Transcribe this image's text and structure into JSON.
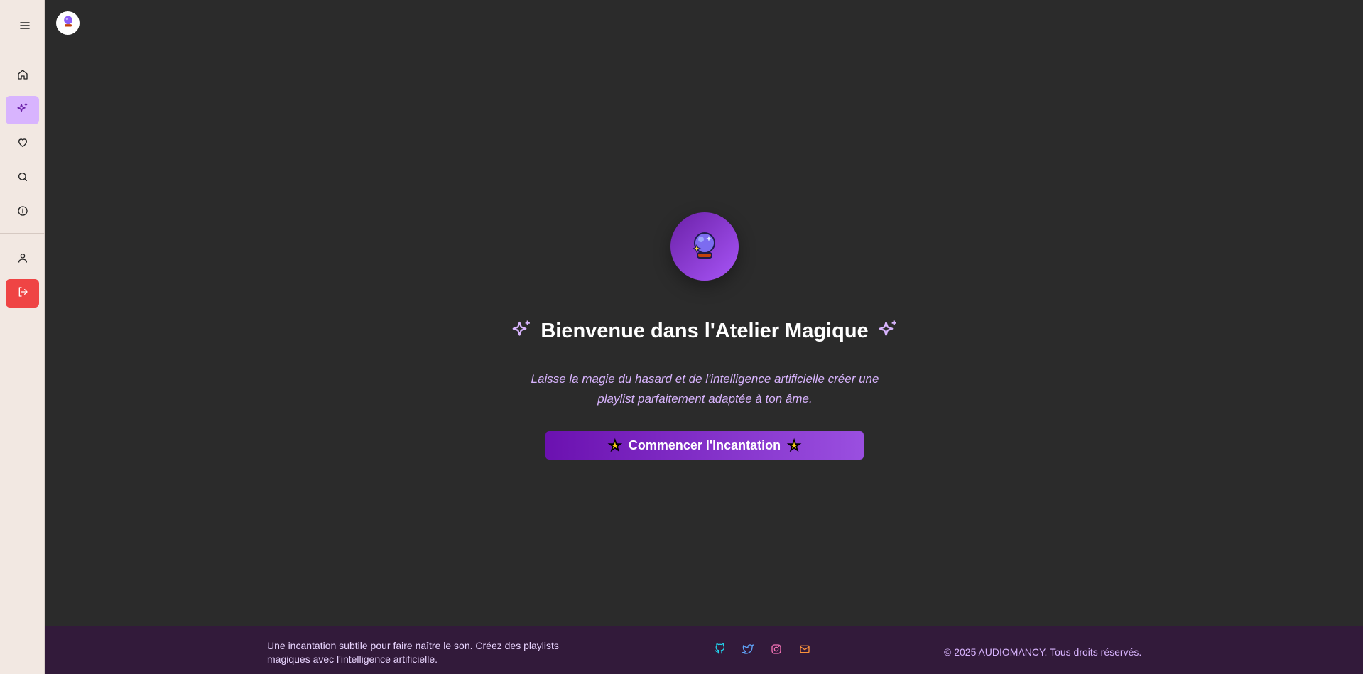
{
  "sidebar": {
    "menu_icon": "hamburger-menu-icon",
    "items": [
      {
        "name": "home",
        "icon": "home-icon"
      },
      {
        "name": "atelier",
        "icon": "sparkles-icon",
        "active": true
      },
      {
        "name": "favorites",
        "icon": "heart-icon"
      },
      {
        "name": "search",
        "icon": "search-icon"
      },
      {
        "name": "about",
        "icon": "info-icon"
      }
    ],
    "bottom_items": [
      {
        "name": "profile",
        "icon": "user-icon"
      },
      {
        "name": "logout",
        "icon": "log-out-icon"
      }
    ]
  },
  "header": {
    "logo_icon": "crystal-ball-icon"
  },
  "main": {
    "hero_icon": "🔮",
    "title": "Bienvenue dans l'Atelier Magique",
    "subtitle": "Laisse la magie du hasard et de l'intelligence artificielle créer une playlist parfaitement adaptée à ton âme.",
    "cta_label": "Commencer l'Incantation",
    "cta_star": "★"
  },
  "footer": {
    "description": "Une incantation subtile pour faire naître le son. Créez des playlists magiques avec l'intelligence artificielle.",
    "socials": [
      {
        "name": "github",
        "icon": "github-icon",
        "color": "#22d3ee"
      },
      {
        "name": "twitter",
        "icon": "twitter-icon",
        "color": "#60a5fa"
      },
      {
        "name": "instagram",
        "icon": "instagram-icon",
        "color": "#f472b6"
      },
      {
        "name": "email",
        "icon": "mail-icon",
        "color": "#fb923c"
      }
    ],
    "copyright": "© 2025 AUDIOMANCY. Tous droits réservés."
  },
  "colors": {
    "accent": "#a855f7",
    "active_bg": "#d8b4fe",
    "logout_bg": "#ef4444",
    "background": "#2b2b2b",
    "footer_bg": "#321a3a"
  }
}
